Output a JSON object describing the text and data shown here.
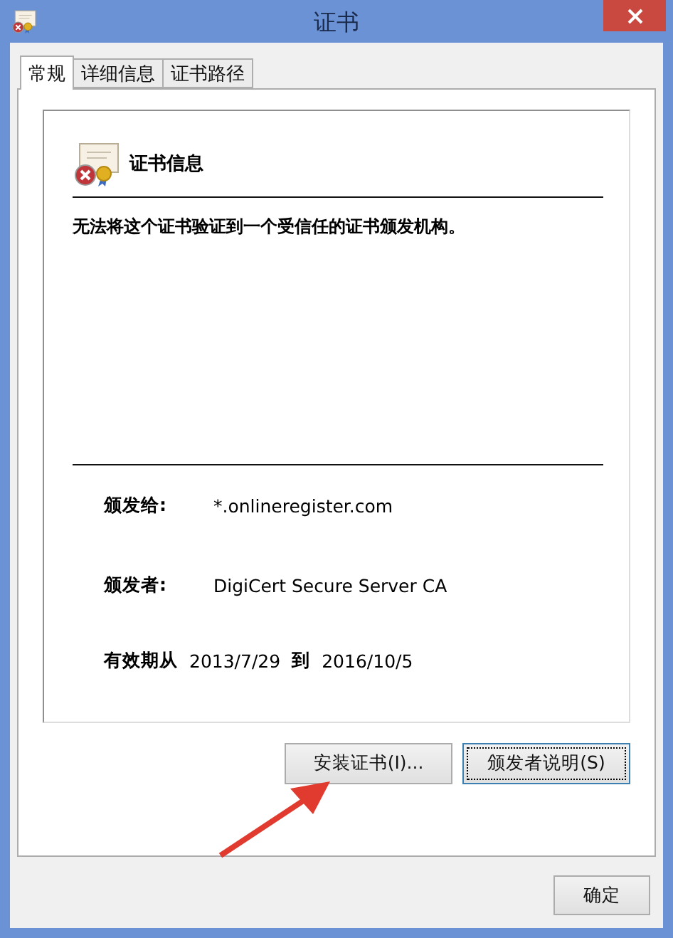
{
  "window": {
    "title": "证书"
  },
  "tabs": [
    {
      "label": "常规",
      "selected": true
    },
    {
      "label": "详细信息",
      "selected": false
    },
    {
      "label": "证书路径",
      "selected": false
    }
  ],
  "info": {
    "heading": "证书信息",
    "message": "无法将这个证书验证到一个受信任的证书颁发机构。",
    "fields": [
      {
        "label": "颁发给:",
        "value": "*.onlineregister.com"
      },
      {
        "label": "颁发者:",
        "value": "DigiCert Secure Server CA"
      }
    ],
    "validity": {
      "from_label": "有效期从",
      "from": "2013/7/29",
      "to_label": "到",
      "to": "2016/10/5"
    }
  },
  "buttons": [
    {
      "label": "安装证书(I)...",
      "focused": false
    },
    {
      "label": "颁发者说明(S)",
      "focused": true
    }
  ],
  "ok_button": "确定"
}
